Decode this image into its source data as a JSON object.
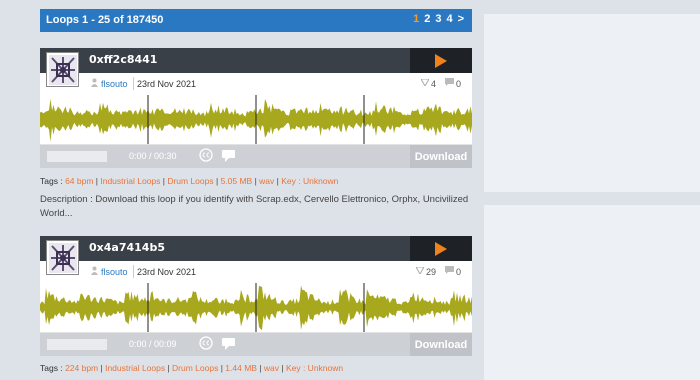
{
  "header": {
    "title": "Loops 1 - 25 of 187450",
    "pages": [
      "1",
      "2",
      "3",
      "4",
      ">"
    ],
    "active_page": "1"
  },
  "loops": [
    {
      "title": "0xff2c8441",
      "user": "flsouto",
      "date": "23rd Nov 2021",
      "downloads": "4",
      "comments": "0",
      "time": "0:00 / 00:30",
      "download_label": "Download",
      "tags_label": "Tags :",
      "tags": [
        "64 bpm",
        "Industrial Loops",
        "Drum Loops",
        "5.05 MB",
        "wav",
        "Key : Unknown"
      ],
      "description": "Description : Download this loop if you identify with Scrap.edx, Cervello Elettronico, Orphx, Uncivilized World..."
    },
    {
      "title": "0x4a7414b5",
      "user": "flsouto",
      "date": "23rd Nov 2021",
      "downloads": "29",
      "comments": "0",
      "time": "0:00 / 00:09",
      "download_label": "Download",
      "tags_label": "Tags :",
      "tags": [
        "224 bpm",
        "Industrial Loops",
        "Drum Loops",
        "1.44 MB",
        "wav",
        "Key : Unknown"
      ]
    }
  ],
  "colors": {
    "header_bg": "#2a78c2",
    "accent_orange": "#f39a2b",
    "tag_orange": "#e8743b",
    "waveform": "#a8a81e",
    "loop_header": "#3a4048"
  },
  "icons": [
    "play-icon",
    "user-icon",
    "download-arrow-icon",
    "comment-icon",
    "creative-commons-icon",
    "chat-icon"
  ]
}
